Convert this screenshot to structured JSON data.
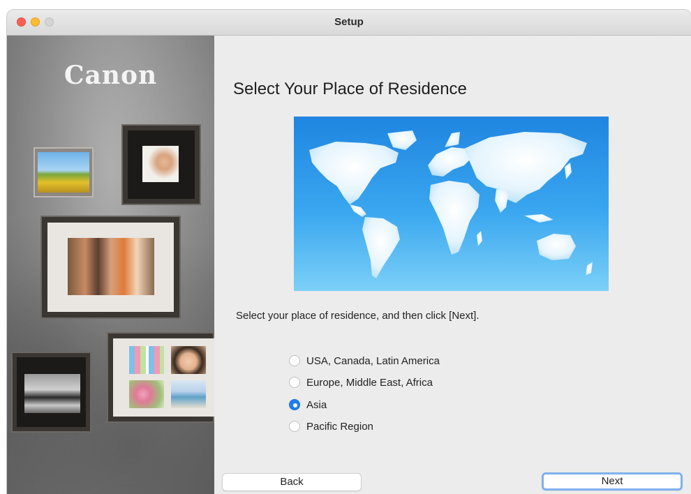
{
  "window": {
    "title": "Setup"
  },
  "side_panel": {
    "logo": "Canon"
  },
  "main": {
    "heading": "Select Your Place of Residence",
    "instruction": "Select your place of residence, and then click [Next].",
    "map_icon": "world-map",
    "regions": [
      {
        "label": "USA, Canada, Latin America",
        "selected": false
      },
      {
        "label": "Europe, Middle East, Africa",
        "selected": false
      },
      {
        "label": "Asia",
        "selected": true
      },
      {
        "label": "Pacific Region",
        "selected": false
      }
    ]
  },
  "buttons": {
    "back": "Back",
    "next": "Next"
  },
  "colors": {
    "accent": "#1f7ef0",
    "map_blue": "#2a97ea",
    "window_bg": "#ececec"
  }
}
